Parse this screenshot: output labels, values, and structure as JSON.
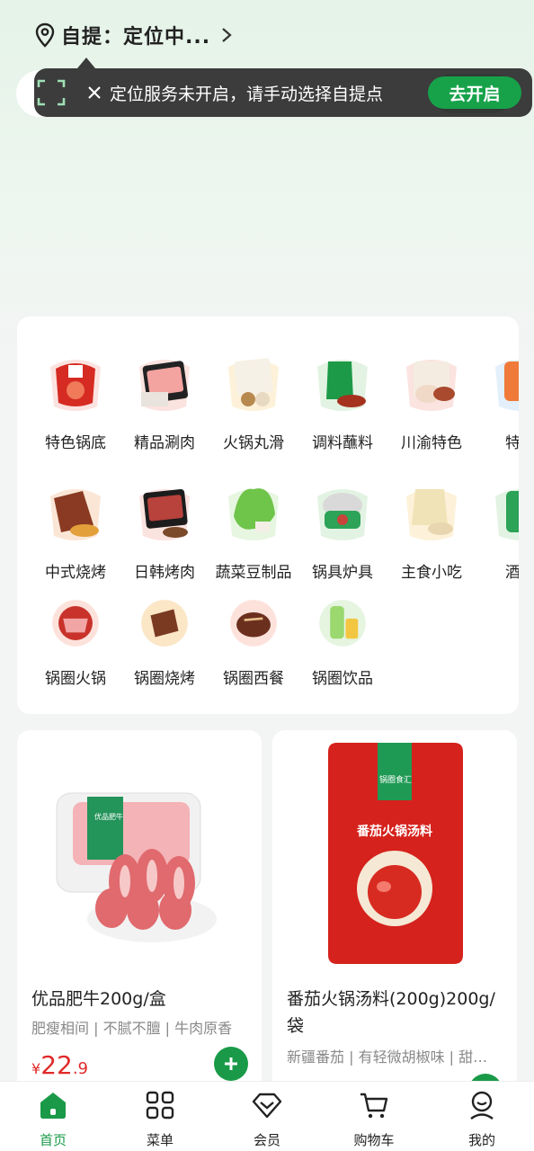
{
  "header": {
    "location_text": "自提：定位中..."
  },
  "toast": {
    "message": "定位服务未开启，请手动选择自提点",
    "action_label": "去开启"
  },
  "categories": [
    {
      "label": "特色锅底",
      "icon": "hotpot-base-icon"
    },
    {
      "label": "精品涮肉",
      "icon": "sliced-meat-icon"
    },
    {
      "label": "火锅丸滑",
      "icon": "meatballs-icon"
    },
    {
      "label": "调料蘸料",
      "icon": "sauce-icon"
    },
    {
      "label": "川渝特色",
      "icon": "sichuan-icon"
    },
    {
      "label": "特色",
      "icon": "special-icon"
    },
    {
      "label": "中式烧烤",
      "icon": "bbq-icon"
    },
    {
      "label": "日韩烤肉",
      "icon": "korean-bbq-icon"
    },
    {
      "label": "蔬菜豆制品",
      "icon": "vegetable-icon"
    },
    {
      "label": "锅具炉具",
      "icon": "cookware-icon"
    },
    {
      "label": "主食小吃",
      "icon": "snack-icon"
    },
    {
      "label": "酒水",
      "icon": "drinks-icon"
    },
    {
      "label": "锅圈火锅",
      "icon": "guoquan-hotpot-icon"
    },
    {
      "label": "锅圈烧烤",
      "icon": "guoquan-bbq-icon"
    },
    {
      "label": "锅圈西餐",
      "icon": "guoquan-western-icon"
    },
    {
      "label": "锅圈饮品",
      "icon": "guoquan-drinks-icon"
    }
  ],
  "products": [
    {
      "title": "优品肥牛200g/盒",
      "subtitle": "肥瘦相间 | 不腻不膻 | 牛肉原香",
      "price_symbol": "¥",
      "price_int": "22",
      "price_dec": ".9",
      "package_label": "优品肥牛"
    },
    {
      "title": "番茄火锅汤料(200g)200g/袋",
      "subtitle": "新疆番茄 | 有轻微胡椒味 | 甜…",
      "package_label": "番茄火锅汤料",
      "brand": "锅圈食汇"
    }
  ],
  "tabbar": [
    {
      "label": "首页",
      "active": true
    },
    {
      "label": "菜单",
      "active": false
    },
    {
      "label": "会员",
      "active": false
    },
    {
      "label": "购物车",
      "active": false
    },
    {
      "label": "我的",
      "active": false
    }
  ],
  "colors": {
    "brand_green": "#1a9a48",
    "price_red": "#e02a2a"
  }
}
